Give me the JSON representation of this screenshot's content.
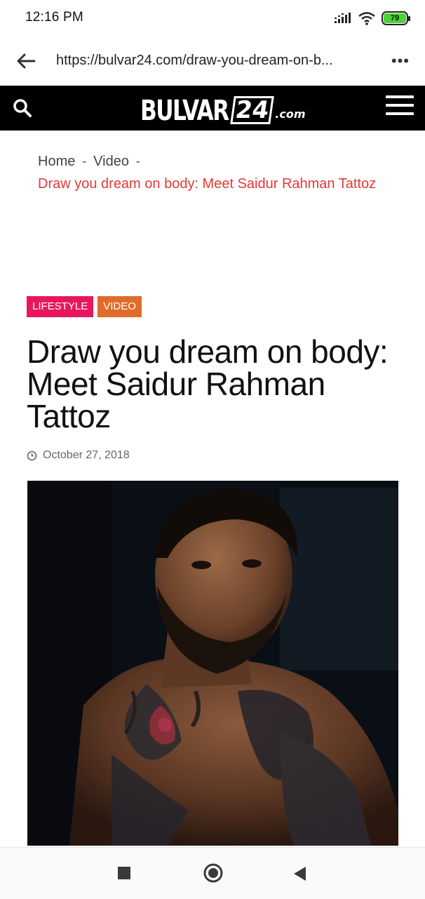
{
  "status_bar": {
    "time": "12:16 PM",
    "battery": "79"
  },
  "browser": {
    "url": "https://bulvar24.com/draw-you-dream-on-b...",
    "more_menu": "•••"
  },
  "site": {
    "logo_main": "BULVAR",
    "logo_number": "24",
    "logo_domain": ".com"
  },
  "breadcrumb": {
    "items": [
      "Home",
      "Video"
    ],
    "separator": "-",
    "current": "Draw you dream on body: Meet Saidur Rahman Tattoz"
  },
  "article": {
    "tags": [
      "LIFESTYLE",
      "VIDEO"
    ],
    "title": "Draw you dream on body: Meet Saidur Rahman Tattoz",
    "date": "October 27, 2018"
  },
  "colors": {
    "header_bg": "#000000",
    "accent_red": "#e53935",
    "tag_lifestyle": "#e8175d",
    "tag_video": "#e06b2a"
  },
  "icons": {
    "search": "search-icon",
    "menu": "hamburger-menu-icon",
    "back": "back-arrow-icon",
    "clock": "clock-icon",
    "signal": "signal-icon",
    "wifi": "wifi-icon"
  }
}
